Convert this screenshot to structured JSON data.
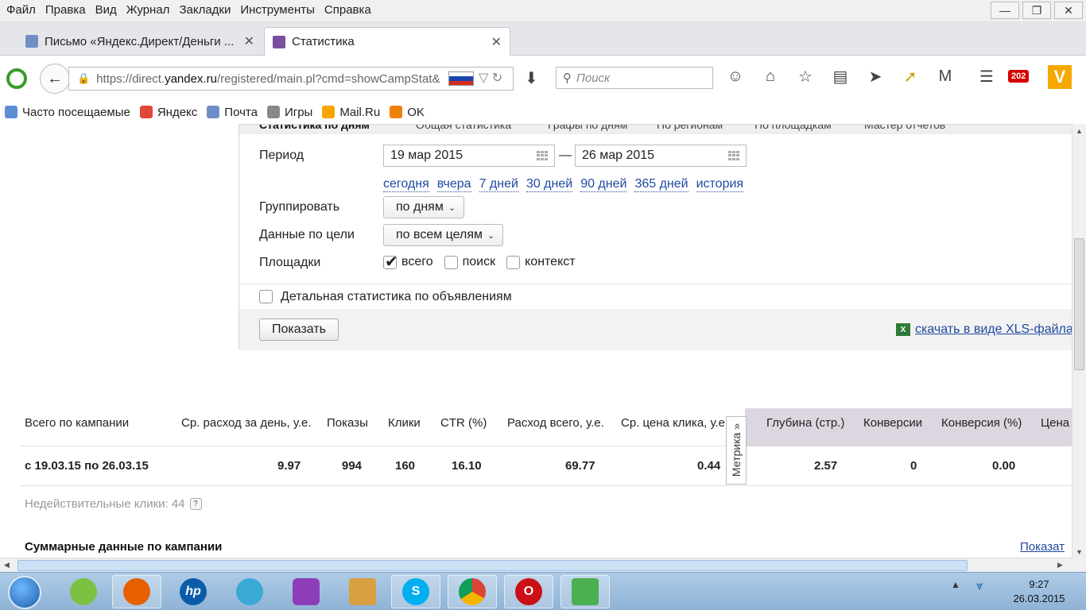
{
  "menu": [
    "Файл",
    "Правка",
    "Вид",
    "Журнал",
    "Закладки",
    "Инструменты",
    "Справка"
  ],
  "tabs": [
    {
      "title": "Письмо «Яндекс.Директ/Деньги ...",
      "active": false
    },
    {
      "title": "Статистика",
      "active": true
    }
  ],
  "address": {
    "prefix": "https://direct.",
    "host": "yandex.ru",
    "suffix": "/registered/main.pl?cmd=showCampStat&"
  },
  "search": {
    "placeholder": "Поиск"
  },
  "mail_badge": "202",
  "bookmarks": [
    "Часто посещаемые",
    "Яндекс",
    "Почта",
    "Игры",
    "Mail.Ru",
    "OK"
  ],
  "panel": {
    "tabs_partial": [
      "Статистика по дням",
      "Общая статистика",
      "Графы по дням",
      "По регионам",
      "По площадкам",
      "Мастер отчетов"
    ],
    "period_label": "Период",
    "date_from": "19 мар 2015",
    "date_to": "26 мар 2015",
    "dash": "—",
    "quick_links": [
      "сегодня",
      "вчера",
      "7 дней",
      "30 дней",
      "90 дней",
      "365 дней",
      "история"
    ],
    "group_label": "Группировать",
    "group_value": "по дням",
    "goal_label": "Данные по цели",
    "goal_value": "по всем целям",
    "platforms_label": "Площадки",
    "platforms": [
      {
        "label": "всего",
        "checked": true
      },
      {
        "label": "поиск",
        "checked": false
      },
      {
        "label": "контекст",
        "checked": false
      }
    ],
    "detail_label": "Детальная статистика по объявлениям",
    "show_button": "Показать",
    "xls_link": "скачать в виде XLS-файла"
  },
  "stats": {
    "headers": [
      "Всего по кампании",
      "Ср. расход за день, у.е.",
      "Показы",
      "Клики",
      "CTR (%)",
      "Расход всего, у.е.",
      "Ср. цена клика, у.е.",
      "Глубина (стр.)",
      "Конверсии",
      "Конверсия (%)",
      "Цена"
    ],
    "total_row": [
      "с 19.03.15 по 26.03.15",
      "9.97",
      "994",
      "160",
      "16.10",
      "69.77",
      "0.44",
      "2.57",
      "0",
      "0.00"
    ],
    "metrika_label": "Метрика »",
    "invalid_clicks": "Недействительные клики: 44",
    "help": "?",
    "summary_title": "Суммарные данные по кампании",
    "show_link": "Показат"
  },
  "taskbar": {
    "time": "9:27",
    "date": "26.03.2015"
  },
  "colors": {
    "link": "#2049a0",
    "metrika_shade": "#ddd6e0",
    "yandex_red": "#d40000"
  }
}
